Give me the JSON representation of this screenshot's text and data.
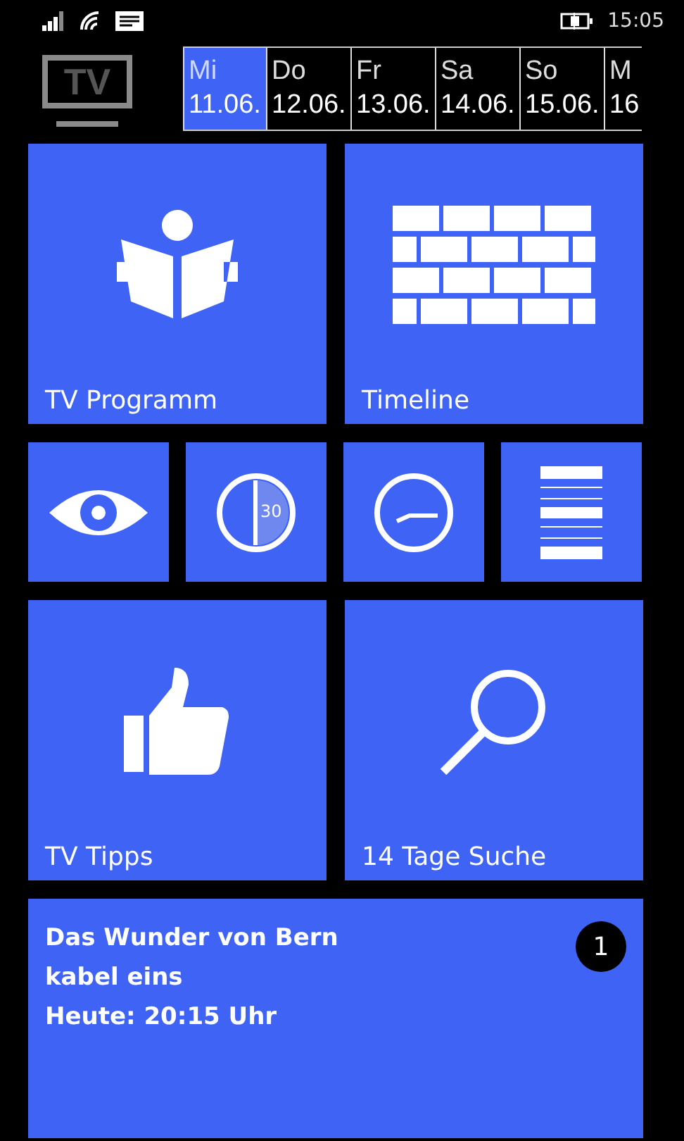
{
  "status_bar": {
    "time": "15:05"
  },
  "logo": {
    "text": "TV"
  },
  "days": [
    {
      "weekday": "Mi",
      "date": "11.06.",
      "selected": true
    },
    {
      "weekday": "Do",
      "date": "12.06.",
      "selected": false
    },
    {
      "weekday": "Fr",
      "date": "13.06.",
      "selected": false
    },
    {
      "weekday": "Sa",
      "date": "14.06.",
      "selected": false
    },
    {
      "weekday": "So",
      "date": "15.06.",
      "selected": false
    },
    {
      "weekday": "M",
      "date": "16",
      "selected": false
    }
  ],
  "tiles": [
    {
      "kind": "reader",
      "label": "TV Programm"
    },
    {
      "kind": "wall",
      "label": "Timeline"
    }
  ],
  "small_tiles": [
    {
      "kind": "eye"
    },
    {
      "kind": "timer",
      "text": "30"
    },
    {
      "kind": "clock"
    },
    {
      "kind": "list"
    }
  ],
  "tiles_2": [
    {
      "kind": "thumb",
      "label": "TV Tipps"
    },
    {
      "kind": "search",
      "label": "14 Tage Suche"
    }
  ],
  "tip": {
    "lines": [
      "Das Wunder von Bern",
      "kabel eins",
      "Heute: 20:15 Uhr"
    ],
    "badge": "1"
  }
}
